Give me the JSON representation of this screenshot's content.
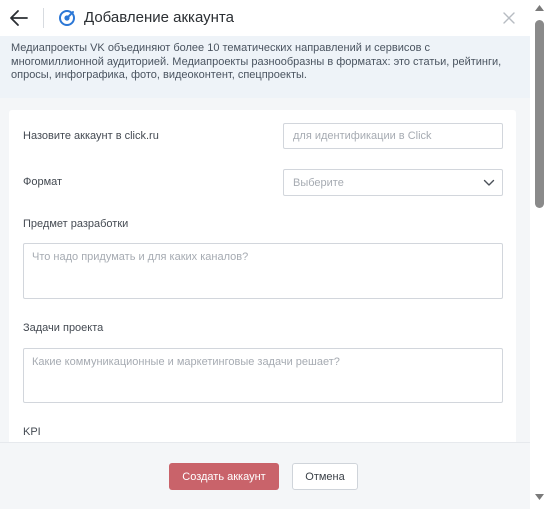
{
  "header": {
    "title": "Добавление аккаунта",
    "back_icon": "arrow-left-icon",
    "close_icon": "close-icon",
    "logo_icon": "vk-media-logo-icon"
  },
  "description": "Медиапроекты VK объединяют более 10 тематических направлений и сервисов с многомиллионной аудиторией. Медиапроекты разнообразны в форматах: это статьи, рейтинги, опросы, инфографика, фото, видеоконтент, спецпроекты.",
  "form": {
    "account_name": {
      "label": "Назовите аккаунт в click.ru",
      "placeholder": "для идентификации в Click"
    },
    "format": {
      "label": "Формат",
      "placeholder": "Выберите"
    },
    "subject": {
      "label": "Предмет разработки",
      "placeholder": "Что надо придумать и для каких каналов?"
    },
    "tasks": {
      "label": "Задачи проекта",
      "placeholder": "Какие коммуникационные и маркетинговые задачи решает?"
    },
    "kpi": {
      "label": "KPI"
    }
  },
  "footer": {
    "create_label": "Создать аккаунт",
    "cancel_label": "Отмена"
  },
  "colors": {
    "accent": "#c9636a",
    "logo": "#2b77d6"
  }
}
